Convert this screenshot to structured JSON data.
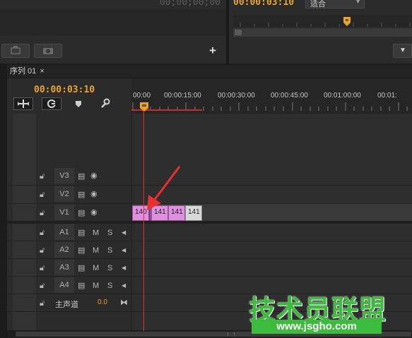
{
  "source_monitor": {
    "timecode": "00;00;00;00",
    "plus_label": "+"
  },
  "program_monitor": {
    "timecode": "00:00:03:10",
    "zoom_select": "适合"
  },
  "sequence": {
    "tab_name": "序列 01",
    "close_glyph": "×",
    "timecode": "00:00:03:10",
    "ruler_labels": [
      "00:00",
      "00:00:15:00",
      "00:00:30:00",
      "00:00:45:00",
      "00:01:00:00",
      "00:01:"
    ]
  },
  "video_tracks": [
    {
      "name": "V3"
    },
    {
      "name": "V2"
    },
    {
      "name": "V1"
    }
  ],
  "audio_tracks": [
    {
      "name": "A1",
      "m": "M",
      "s": "S"
    },
    {
      "name": "A2",
      "m": "M",
      "s": "S"
    },
    {
      "name": "A3",
      "m": "M",
      "s": "S"
    },
    {
      "name": "A4",
      "m": "M",
      "s": "S"
    }
  ],
  "master_track": {
    "name": "主声道",
    "level": "0.0"
  },
  "clips": [
    "140",
    "141",
    "141",
    "141"
  ],
  "watermark": {
    "title": "技术员联盟",
    "url": "www.jsgho.com"
  },
  "colors": {
    "accent": "#e8a52c",
    "playhead": "#e03030",
    "clip_pink": "#e08ee0",
    "clip_gray": "#d8d8d8",
    "watermark_green": "#3dbb3d"
  }
}
